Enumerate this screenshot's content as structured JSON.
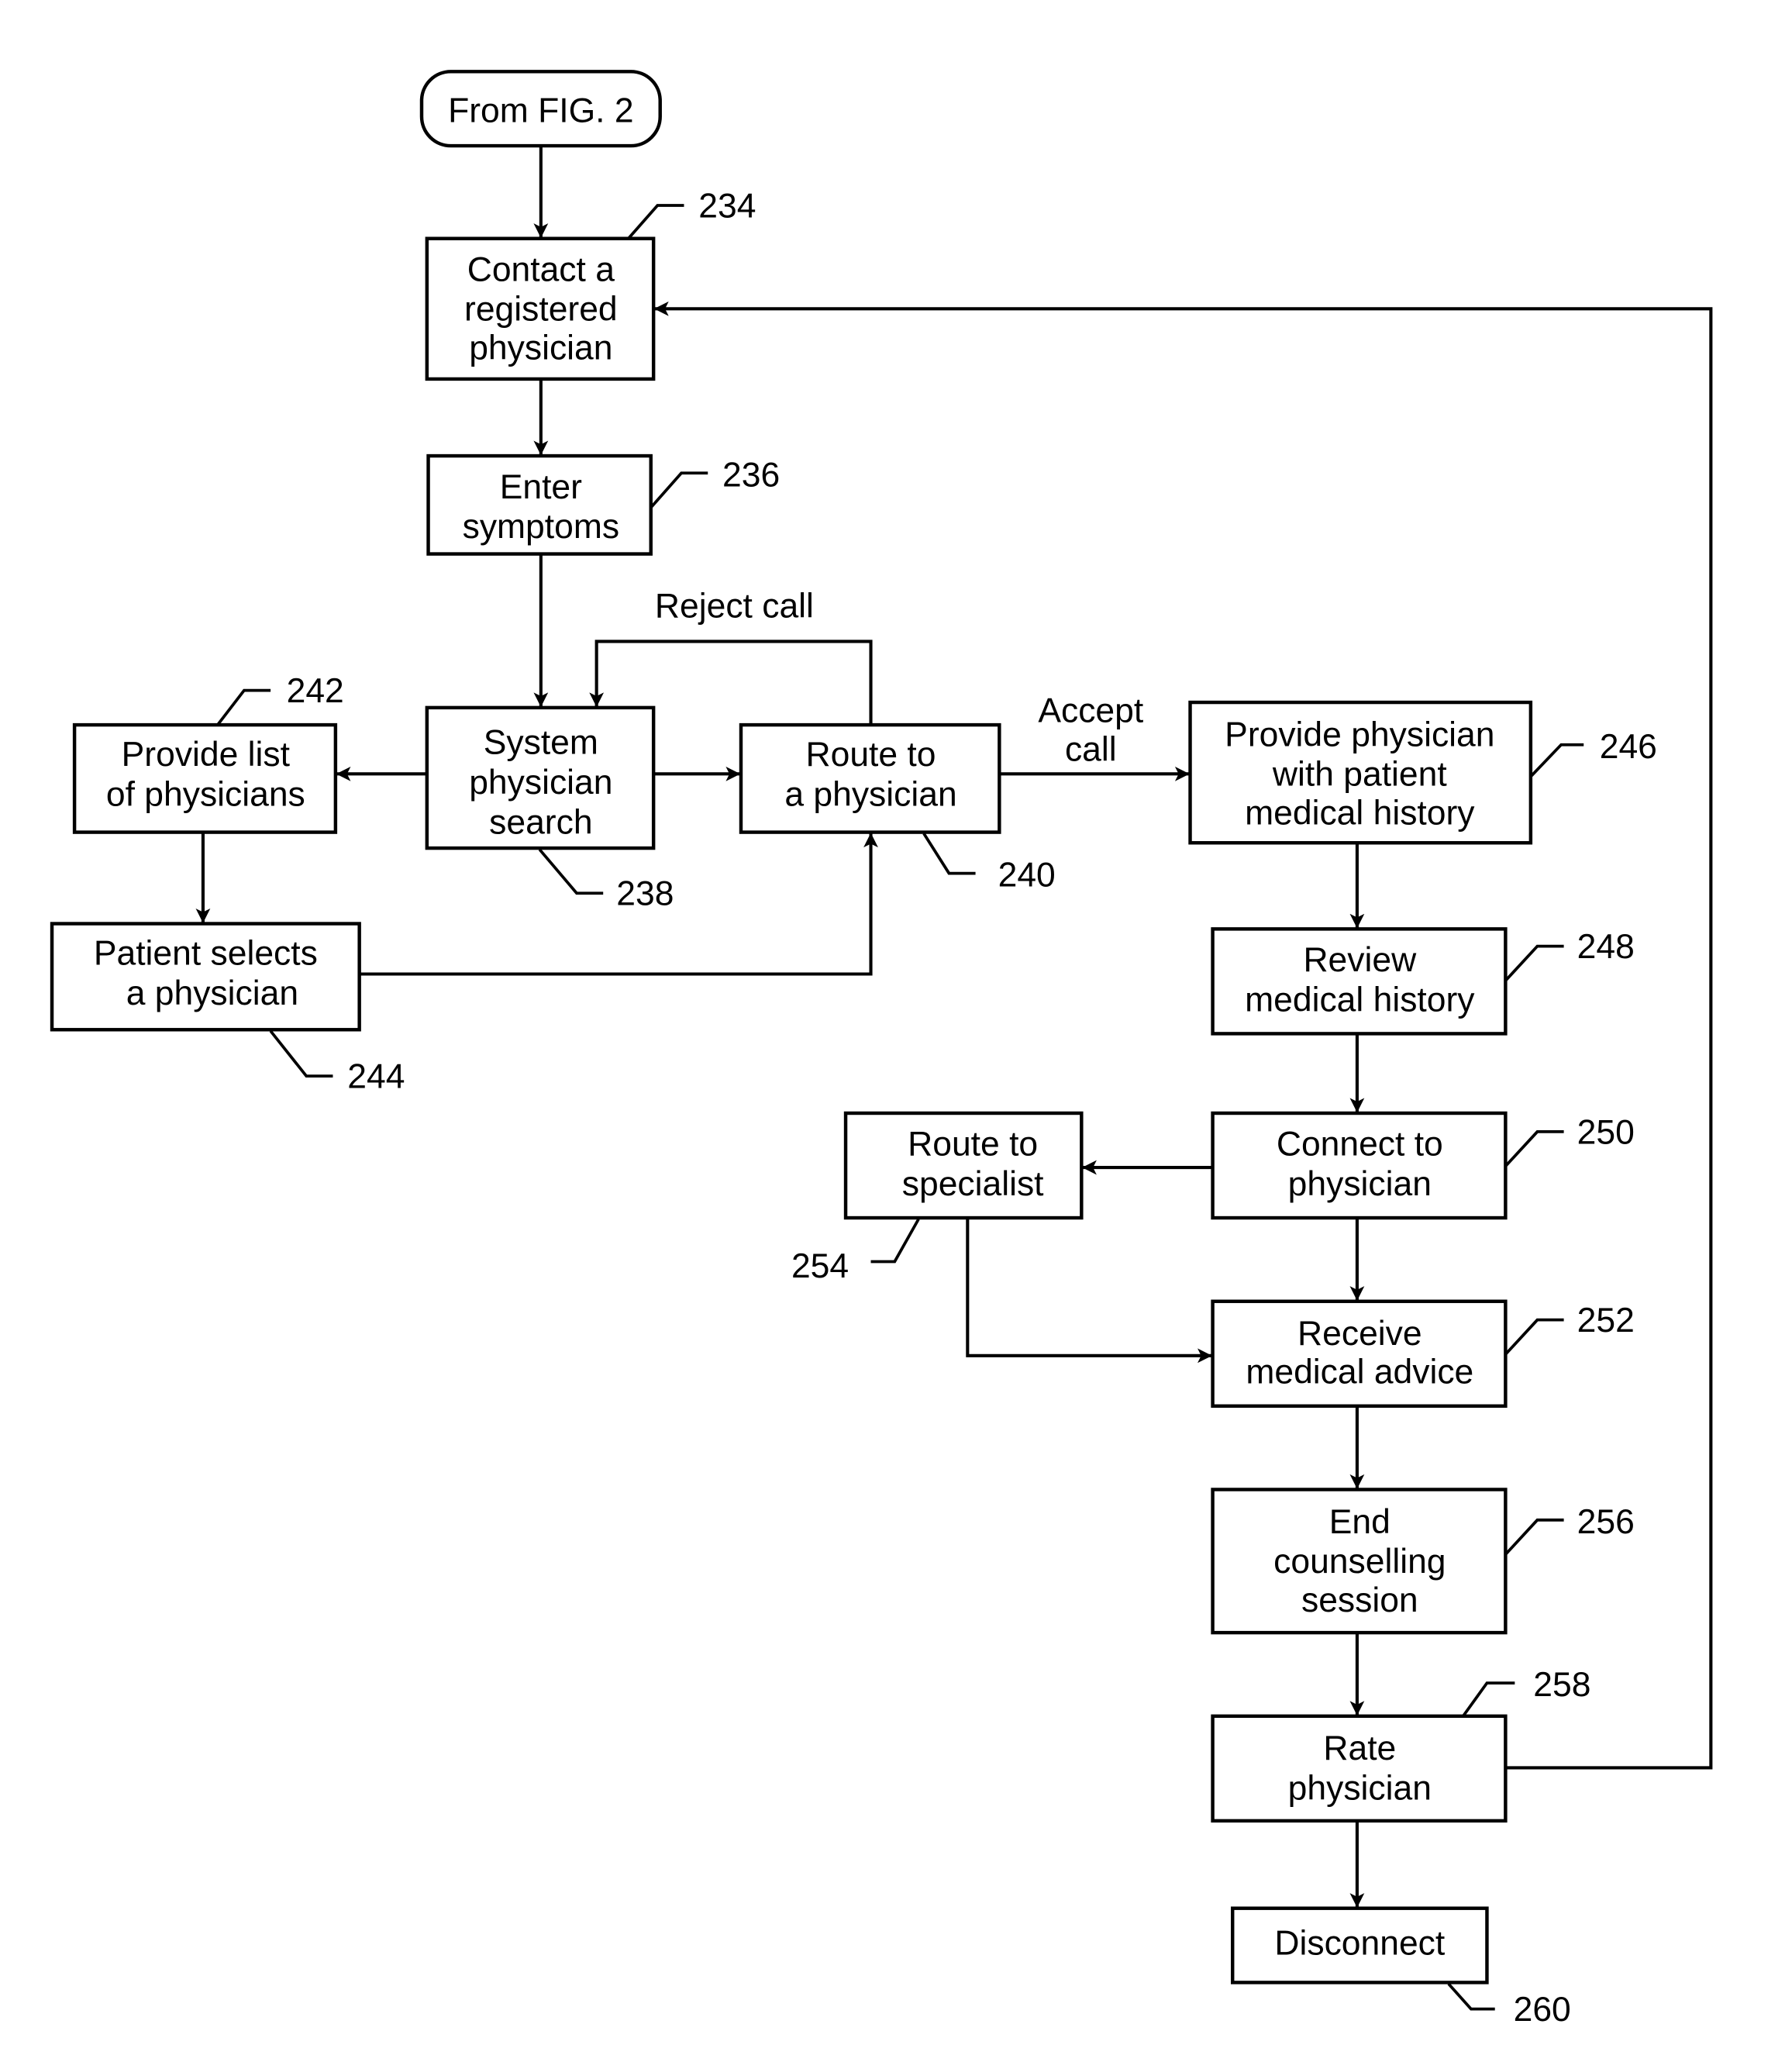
{
  "figure": {
    "start_terminal": "From FIG. 2",
    "nodes": [
      {
        "id": "234",
        "ref": "234",
        "lines": [
          "Contact a",
          "registered",
          "physician"
        ]
      },
      {
        "id": "236",
        "ref": "236",
        "lines": [
          "Enter",
          "symptoms"
        ]
      },
      {
        "id": "238",
        "ref": "238",
        "lines": [
          "System",
          "physician",
          "search"
        ]
      },
      {
        "id": "240",
        "ref": "240",
        "lines": [
          "Route to",
          "a physician"
        ]
      },
      {
        "id": "242",
        "ref": "242",
        "lines": [
          "Provide list",
          "of physicians"
        ]
      },
      {
        "id": "244",
        "ref": "244",
        "lines": [
          "Patient selects",
          "a physician"
        ]
      },
      {
        "id": "246",
        "ref": "246",
        "lines": [
          "Provide physician",
          "with patient",
          "medical history"
        ]
      },
      {
        "id": "248",
        "ref": "248",
        "lines": [
          "Review",
          "medical history"
        ]
      },
      {
        "id": "250",
        "ref": "250",
        "lines": [
          "Connect to",
          "physician"
        ]
      },
      {
        "id": "254",
        "ref": "254",
        "lines": [
          "Route to",
          "specialist"
        ]
      },
      {
        "id": "252",
        "ref": "252",
        "lines": [
          "Receive",
          "medical advice"
        ]
      },
      {
        "id": "256",
        "ref": "256",
        "lines": [
          "End",
          "counselling",
          "session"
        ]
      },
      {
        "id": "258",
        "ref": "258",
        "lines": [
          "Rate",
          "physician"
        ]
      },
      {
        "id": "260",
        "ref": "260",
        "lines": [
          "Disconnect"
        ]
      }
    ],
    "edge_labels": {
      "reject_call": "Reject call",
      "accept_call": [
        "Accept",
        "call"
      ]
    },
    "edges": [
      {
        "from": "start",
        "to": "234"
      },
      {
        "from": "234",
        "to": "236"
      },
      {
        "from": "236",
        "to": "238"
      },
      {
        "from": "238",
        "to": "242"
      },
      {
        "from": "238",
        "to": "240"
      },
      {
        "from": "240",
        "to": "238",
        "label": "Reject call"
      },
      {
        "from": "240",
        "to": "246",
        "label": "Accept call"
      },
      {
        "from": "242",
        "to": "244"
      },
      {
        "from": "244",
        "to": "240"
      },
      {
        "from": "246",
        "to": "248"
      },
      {
        "from": "248",
        "to": "250"
      },
      {
        "from": "250",
        "to": "254"
      },
      {
        "from": "250",
        "to": "252"
      },
      {
        "from": "254",
        "to": "252"
      },
      {
        "from": "252",
        "to": "256"
      },
      {
        "from": "256",
        "to": "258"
      },
      {
        "from": "258",
        "to": "234"
      },
      {
        "from": "258",
        "to": "260"
      }
    ]
  }
}
